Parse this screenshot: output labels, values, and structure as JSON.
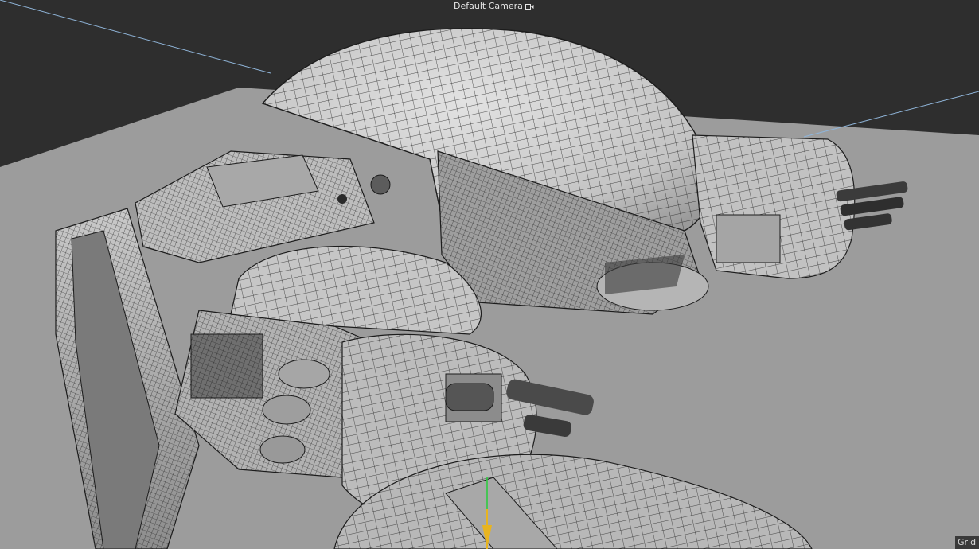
{
  "viewport": {
    "camera_label": "Default Camera",
    "camera_icon": "camera-icon",
    "grid_label": "Grid S"
  },
  "colors": {
    "background": "#2e2e2e",
    "floor": "#9c9c9c",
    "model_shade": "#c8c8c8",
    "wireframe": "#1c1c1c",
    "axis_y": "#2ecc40",
    "axis_z": "#e8b420",
    "guide_line": "#8fb4d8"
  }
}
